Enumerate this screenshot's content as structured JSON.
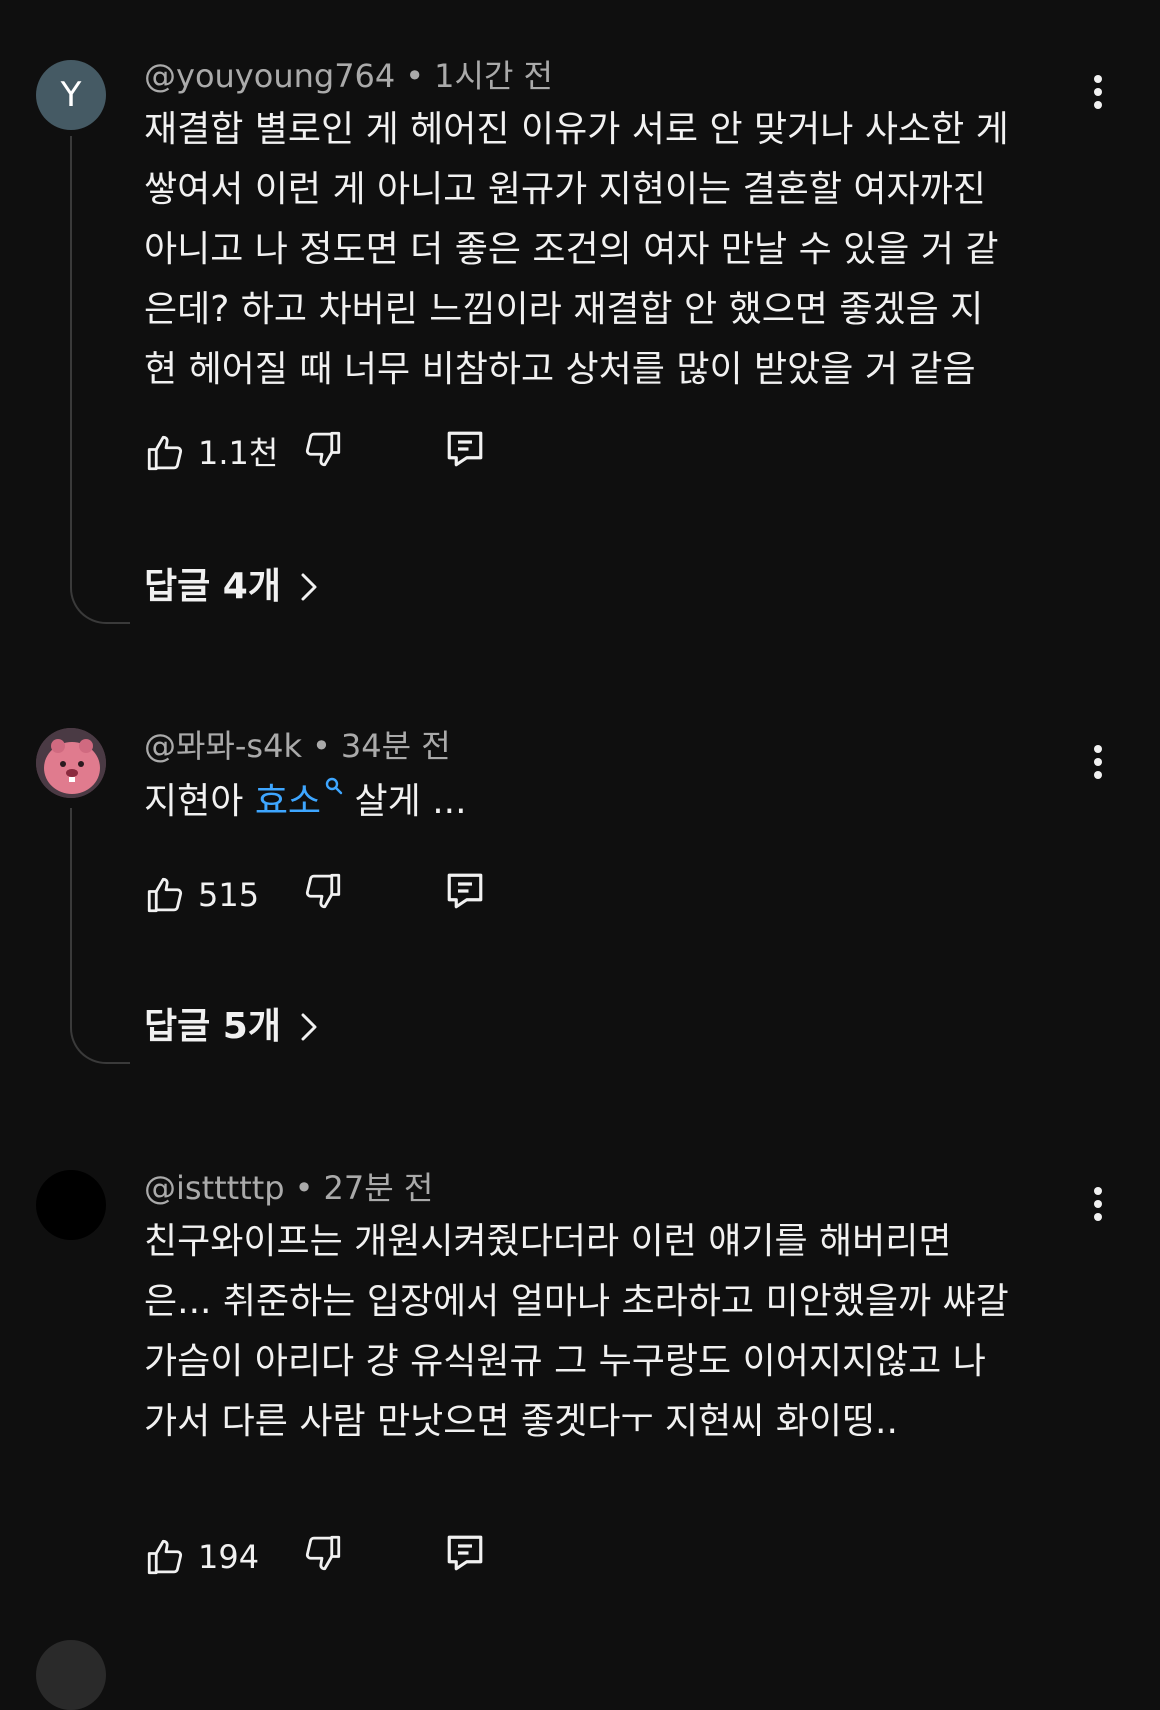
{
  "comments": [
    {
      "avatar_letter": "Y",
      "author": "@youyoung764",
      "time": "1시간 전",
      "text": "재결합 별로인 게 헤어진 이유가 서로 안 맞거나 사소한 게\n쌓여서 이런 게 아니고 원규가 지현이는 결혼할 여자까진\n아니고 나 정도면 더 좋은 조건의 여자 만날 수 있을 거 같\n은데? 하고 차버린 느낌이라 재결합 안 했으면 좋겠음 지\n현 헤어질 때 너무 비참하고 상처를 많이 받았을 거 같음",
      "likes": "1.1천",
      "replies": "답글 4개"
    },
    {
      "author": "@뫄뫄-s4k",
      "time": "34분 전",
      "text_before": "지현아 ",
      "link_text": "효소",
      "text_after": " 살게 ...",
      "likes": "515",
      "replies": "답글 5개"
    },
    {
      "author": "@istttttp",
      "time": "27분 전",
      "text": "친구와이프는 개원시켜줬다더라 이런 얘기를 해버리면\n은... 취준하는 입장에서 얼마나 초라하고 미안했을까 쌰갈\n가슴이 아리다 걍 유식원규 그 누구랑도 이어지지않고 나\n가서 다른 사람 만낫으면 좋겟다ㅜ 지현씨 화이띵..",
      "likes": "194"
    }
  ],
  "icons": {
    "like": "thumbs-up-icon",
    "dislike": "thumbs-down-icon",
    "reply": "comment-reply-icon",
    "more": "more-vertical-icon",
    "chevron": "chevron-right-icon",
    "search": "search-icon"
  },
  "colors": {
    "background": "#0f0f0f",
    "text": "#f1f1f1",
    "meta": "#aaaaaa",
    "link": "#3ea6ff",
    "avatar_y": "#455a64"
  }
}
